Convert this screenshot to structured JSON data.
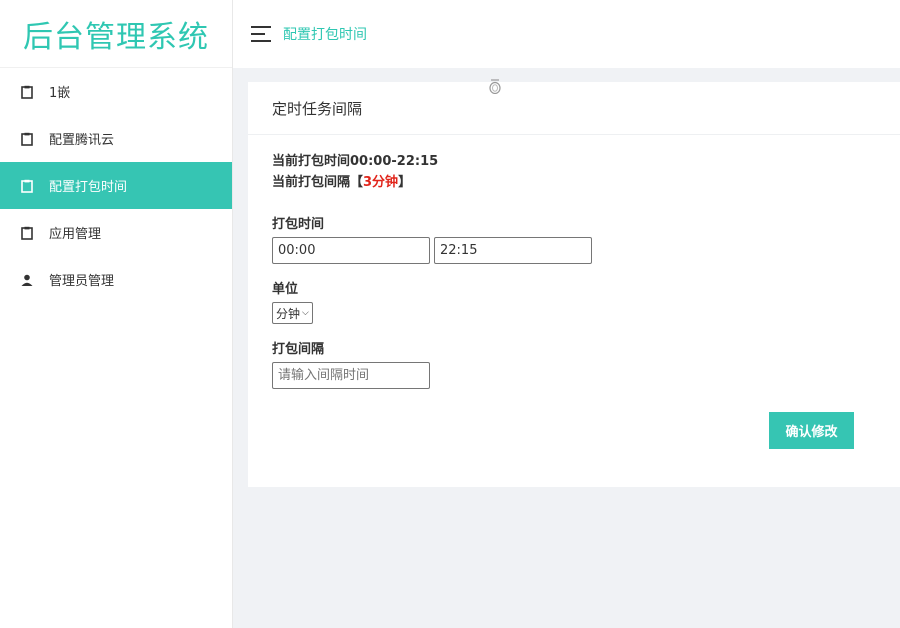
{
  "logo": "后台管理系统",
  "sidebar": {
    "items": [
      {
        "label": "1嵌",
        "icon": "clipboard-icon"
      },
      {
        "label": "配置腾讯云",
        "icon": "clipboard-icon"
      },
      {
        "label": "配置打包时间",
        "icon": "clipboard-icon",
        "active": true
      },
      {
        "label": "应用管理",
        "icon": "clipboard-icon"
      },
      {
        "label": "管理员管理",
        "icon": "user-icon"
      }
    ]
  },
  "topbar": {
    "title": "配置打包时间",
    "icon": "hamburger-icon"
  },
  "card": {
    "title": "定时任务间隔",
    "current_time_label": "当前打包时间00:00-22:15",
    "current_interval_prefix": "当前打包间隔【",
    "current_interval_value": "3分钟",
    "current_interval_suffix": "】",
    "pack_time_label": "打包时间",
    "start_time": "00:00",
    "end_time": "22:15",
    "unit_label": "单位",
    "unit_selected": "分钟",
    "interval_label": "打包间隔",
    "interval_placeholder": "请输入间隔时间",
    "confirm_button": "确认修改"
  },
  "colors": {
    "accent": "#36c5b3",
    "logo": "#2fc7b2",
    "highlight": "#e1251b"
  }
}
